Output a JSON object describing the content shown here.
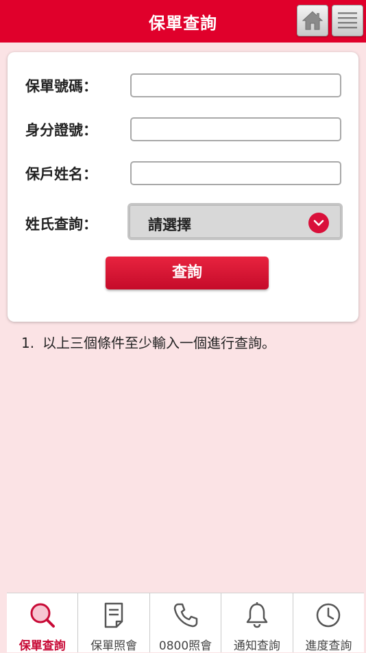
{
  "header": {
    "title": "保單查詢",
    "home_icon": "home-icon",
    "menu_icon": "menu-icon"
  },
  "form": {
    "policy_no_label": "保單號碼：",
    "policy_no_value": "",
    "id_no_label": "身分證號：",
    "id_no_value": "",
    "holder_name_label": "保戶姓名：",
    "holder_name_value": "",
    "surname_label": "姓氏查詢：",
    "surname_select_value": "請選擇",
    "submit_label": "查詢"
  },
  "notes": [
    {
      "num": "1.",
      "text": "以上三個條件至少輸入一個進行查詢。"
    }
  ],
  "tabbar": {
    "items": [
      {
        "label": "保單查詢",
        "icon": "search-icon",
        "active": true
      },
      {
        "label": "保單照會",
        "icon": "document-icon",
        "active": false
      },
      {
        "label": "0800照會",
        "icon": "phone-icon",
        "active": false
      },
      {
        "label": "通知查詢",
        "icon": "bell-icon",
        "active": false
      },
      {
        "label": "進度查詢",
        "icon": "clock-icon",
        "active": false
      }
    ]
  },
  "colors": {
    "brand_red": "#e0002b",
    "page_bg": "#fbe3e5",
    "active_tab": "#c80a36"
  }
}
